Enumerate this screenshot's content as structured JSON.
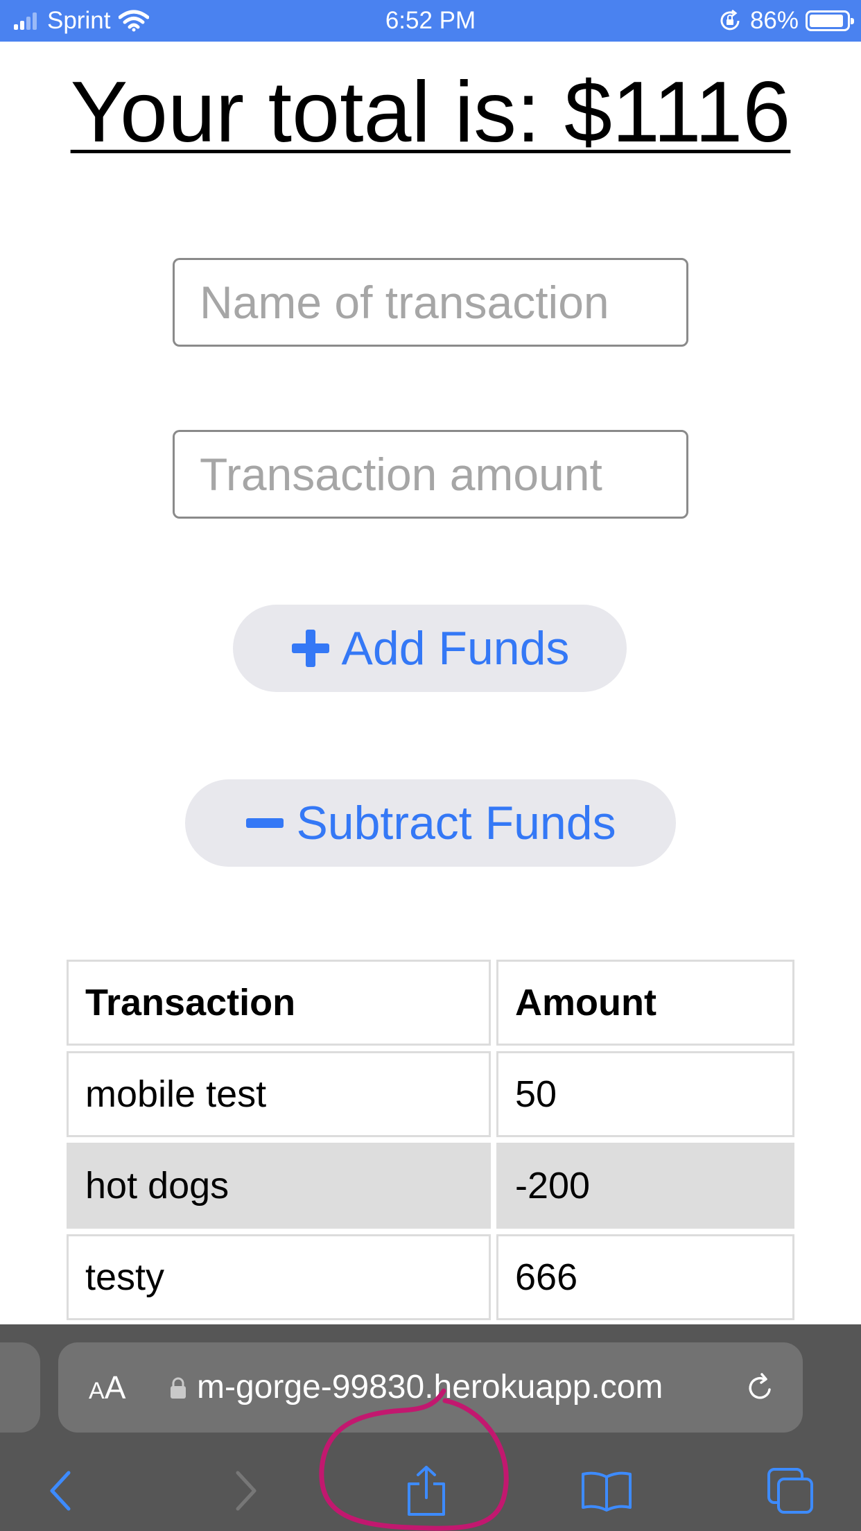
{
  "status_bar": {
    "carrier": "Sprint",
    "time": "6:52 PM",
    "battery_percent": "86%",
    "battery_level": 0.86,
    "icons": [
      "signal-icon",
      "wifi-icon",
      "rotation-lock-icon",
      "battery-icon"
    ]
  },
  "page": {
    "heading": "Your total is: $1116"
  },
  "form": {
    "name_placeholder": "Name of transaction",
    "amount_placeholder": "Transaction amount",
    "add_label": "Add Funds",
    "subtract_label": "Subtract Funds",
    "add_icon": "plus-icon",
    "subtract_icon": "minus-icon"
  },
  "table": {
    "headers": [
      "Transaction",
      "Amount"
    ],
    "rows": [
      {
        "name": "mobile test",
        "amount": "50"
      },
      {
        "name": "hot dogs",
        "amount": "-200"
      },
      {
        "name": "testy",
        "amount": "666"
      }
    ]
  },
  "browser": {
    "aa_small": "A",
    "aa_large": "A",
    "url": "m-gorge-99830.herokuapp.com",
    "icons": [
      "lock-icon",
      "reload-icon",
      "back-icon",
      "forward-icon",
      "share-icon",
      "bookmarks-icon",
      "tabs-icon"
    ]
  },
  "colors": {
    "status_bar": "#4a82f0",
    "button_text": "#3478f6",
    "button_bg": "#e8e8ed",
    "annotation": "#c2186f",
    "browser_chrome": "#565656"
  }
}
